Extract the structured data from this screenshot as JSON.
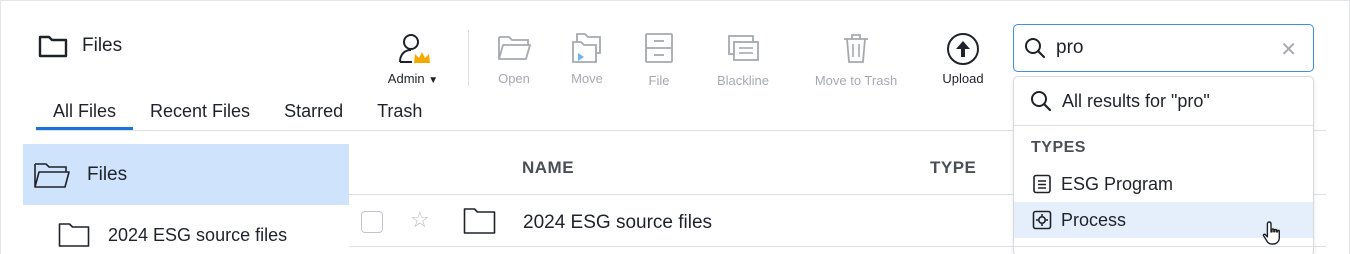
{
  "header": {
    "title": "Files"
  },
  "toolbar": {
    "admin_label": "Admin",
    "open_label": "Open",
    "move_label": "Move",
    "file_label": "File",
    "blackline_label": "Blackline",
    "trash_label": "Move to Trash",
    "upload_label": "Upload"
  },
  "tabs": [
    "All Files",
    "Recent Files",
    "Starred",
    "Trash"
  ],
  "sidebar": {
    "selected": "Files",
    "items": [
      "2024 ESG source files"
    ]
  },
  "table": {
    "columns": [
      "NAME",
      "TYPE"
    ],
    "rows": [
      {
        "name": "2024 ESG source files"
      }
    ]
  },
  "search": {
    "value": "pro",
    "dropdown": {
      "all_results": "All results for \"pro\"",
      "types_heading": "TYPES",
      "types": [
        "ESG Program",
        "Process"
      ]
    }
  },
  "colors": {
    "accent": "#1a73d9",
    "selected_bg": "#cfe3fc",
    "highlight_bg": "#e5effc",
    "admin_crown": "#f5a800"
  }
}
